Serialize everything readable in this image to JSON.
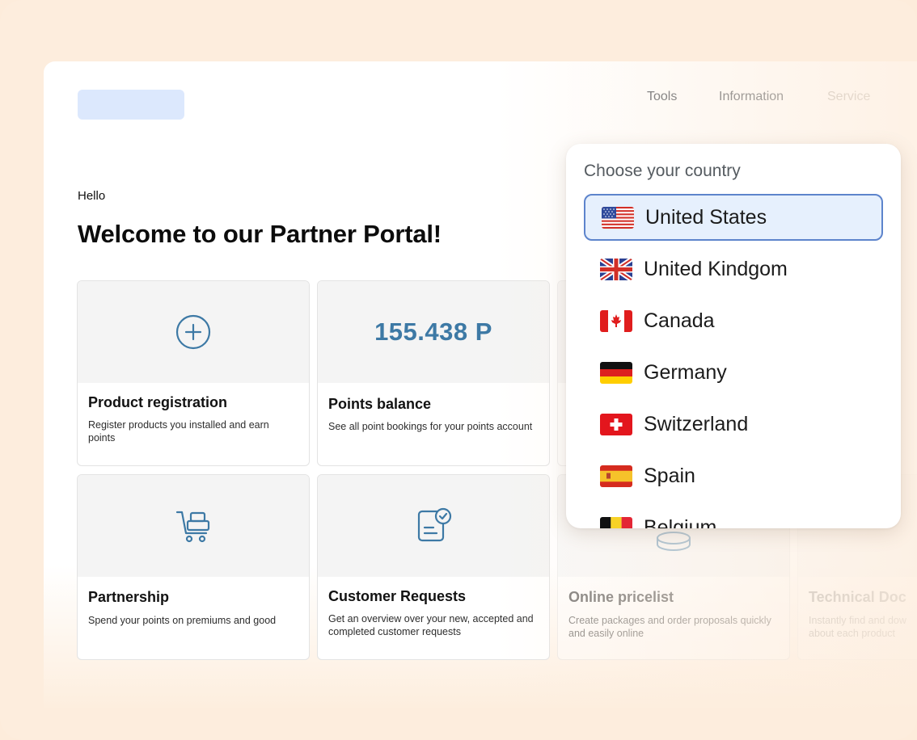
{
  "header": {
    "nav": [
      "Tools",
      "Information",
      "Service"
    ]
  },
  "main": {
    "greeting": "Hello",
    "title": "Welcome to our Partner Portal!"
  },
  "cards": [
    {
      "title": "Product registration",
      "description": "Register products you installed and earn points",
      "icon": "plus-circle-icon"
    },
    {
      "title": "Points balance",
      "description": "See all point bookings for your points account",
      "value": "155.438 P"
    },
    {
      "title": "Partnership",
      "description": "Spend your points on premiums and good",
      "icon": "shopping-cart-icon"
    },
    {
      "title": "Customer Requests",
      "description": "Get an overview over your new, accepted and completed customer requests",
      "icon": "document-check-icon"
    },
    {
      "title": "Online pricelist",
      "description": "Create packages and order proposals quickly and easily online",
      "icon": "coins-icon"
    },
    {
      "title": "Technical Doc",
      "description": "Instantly find and dow about each product"
    }
  ],
  "country_picker": {
    "title": "Choose your country",
    "selected": "United States",
    "countries": [
      {
        "name": "United States",
        "flag": "us-flag-icon"
      },
      {
        "name": "United Kindgom",
        "flag": "uk-flag-icon"
      },
      {
        "name": "Canada",
        "flag": "canada-flag-icon"
      },
      {
        "name": "Germany",
        "flag": "germany-flag-icon"
      },
      {
        "name": "Switzerland",
        "flag": "switzerland-flag-icon"
      },
      {
        "name": "Spain",
        "flag": "spain-flag-icon"
      },
      {
        "name": "Belgium",
        "flag": "belgium-flag-icon"
      }
    ]
  },
  "colors": {
    "accent": "#3d79a5",
    "selected_bg": "#e6f0fd",
    "selected_border": "#5d84cc",
    "page_bg": "#fdeddd"
  }
}
